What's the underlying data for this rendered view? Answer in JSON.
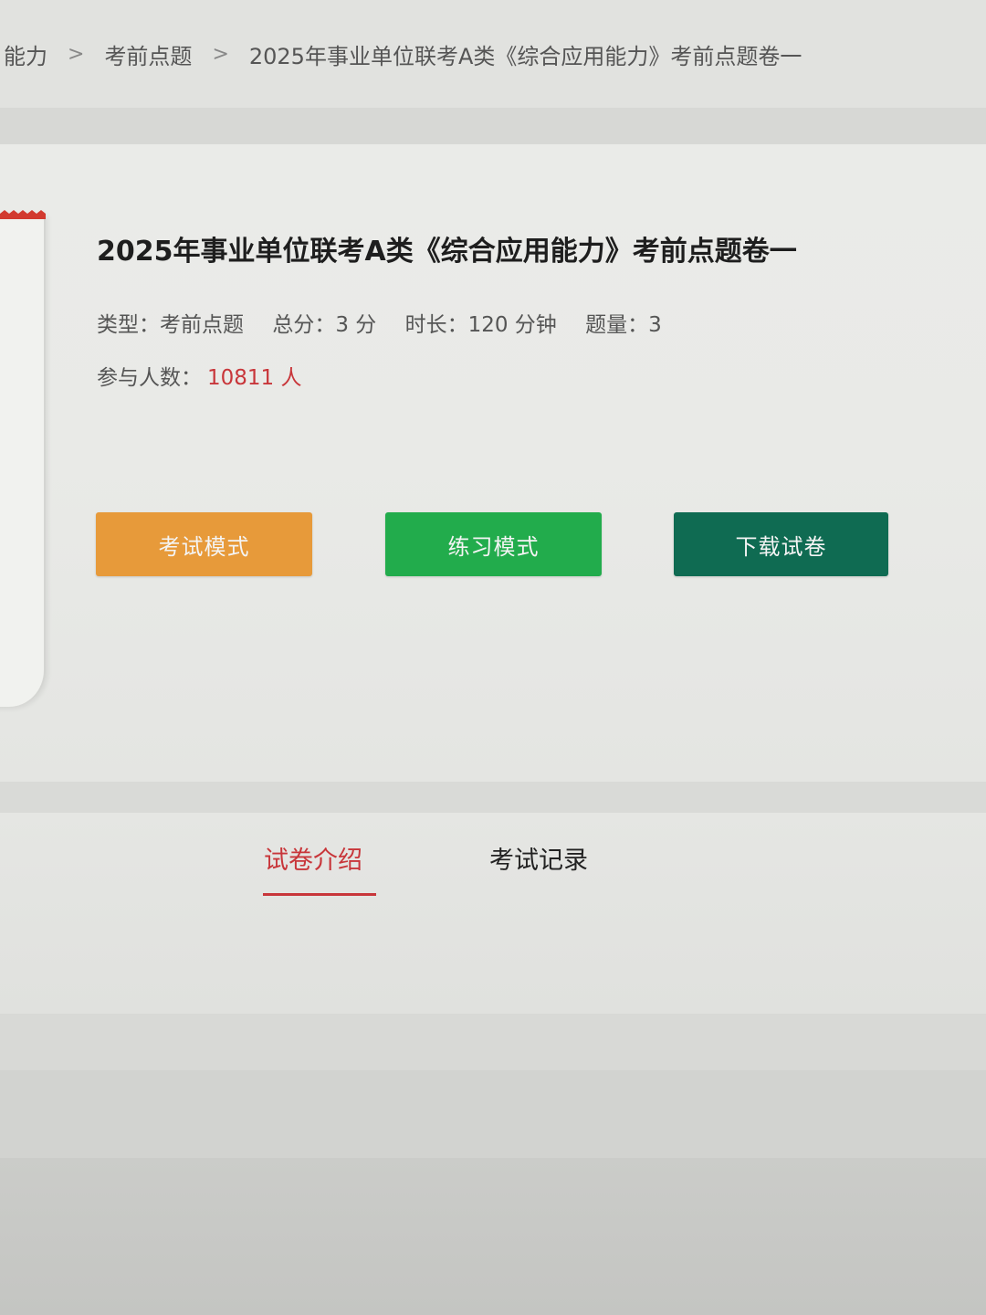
{
  "breadcrumb": {
    "items": [
      "能力",
      "考前点题",
      "2025年事业单位联考A类《综合应用能力》考前点题卷一"
    ],
    "separator": ">"
  },
  "paper": {
    "title": "2025年事业单位联考A类《综合应用能力》考前点题卷一",
    "type_text": "类型：考前点题",
    "score_text": "总分：3 分",
    "duration_text": "时长：120 分钟",
    "questions_text": "题量：3",
    "participants_label": "参与人数：",
    "participants_count": "10811 人"
  },
  "actions": {
    "exam_mode": "考试模式",
    "practice_mode": "练习模式",
    "download": "下载试卷"
  },
  "tabs": {
    "intro": "试卷介绍",
    "records": "考试记录",
    "active": "intro"
  },
  "colors": {
    "exam_button": "#e79a3a",
    "practice_button": "#22ac4c",
    "download_button": "#0f6b52",
    "accent_red": "#c8363a"
  }
}
